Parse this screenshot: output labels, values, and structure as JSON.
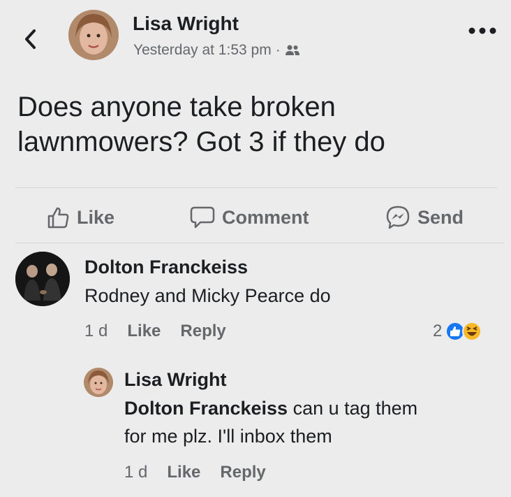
{
  "post": {
    "author": "Lisa Wright",
    "timestamp": "Yesterday at 1:53 pm",
    "separator": "·",
    "audience_icon": "friends-icon",
    "text_line1": "Does anyone take broken",
    "text_line2": "lawnmowers? Got 3 if they do"
  },
  "actions": {
    "like": "Like",
    "comment": "Comment",
    "send": "Send"
  },
  "comments": [
    {
      "author": "Dolton Franckeiss",
      "text": "Rodney and Micky Pearce do",
      "time": "1 d",
      "like": "Like",
      "reply": "Reply",
      "reaction_count": "2"
    }
  ],
  "reply": {
    "author": "Lisa Wright",
    "mention": "Dolton Franckeiss",
    "text_part1": " can u tag them",
    "text_line2": "for me plz. I'll inbox them",
    "time": "1 d",
    "like": "Like",
    "reply": "Reply"
  },
  "colors": {
    "background": "#ececec",
    "text": "#1c1e21",
    "secondary": "#65676b",
    "like_blue": "#1877f2",
    "haha_yellow": "#f7b928"
  }
}
